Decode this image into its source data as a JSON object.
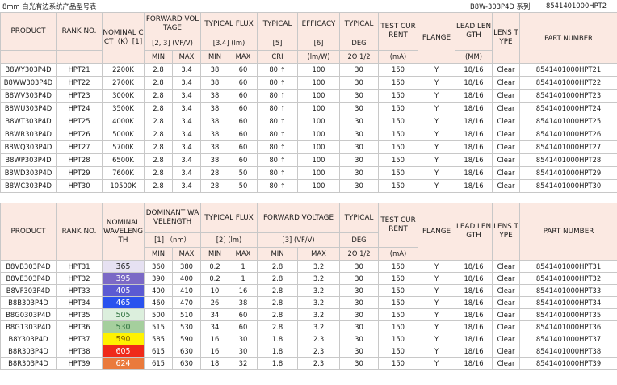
{
  "title": {
    "left": "8mm 白光有边系统产品型号表",
    "middle": "B8W-303P4D 系列",
    "right": "8541401000HPT2"
  },
  "table1": {
    "header": {
      "product": "PRODUCT",
      "rank": "RANK NO.",
      "cct": "NOMINAL CCT（K）[1]",
      "fv": "FORWARD VOLTAGE",
      "fv_sub": "[2, 3] (VF/V)",
      "flux": "TYPICAL FLUX",
      "flux_sub": "[3.4] (lm)",
      "typical": "TYPICAL",
      "typical_sub": "[5]",
      "efficacy": "EFFICACY",
      "efficacy_sub": "[6]",
      "typical2": "TYPICAL",
      "deg": "DEG",
      "test_current": "TEST CURRENT",
      "ma": "(mA)",
      "flange": "FLANGE",
      "lead_length": "LEAD LENGTH",
      "mm": "(MM)",
      "lens_type": "LENS TYPE",
      "part_number": "PART NUMBER",
      "min": "MIN",
      "max": "MAX",
      "min2": "MIN",
      "max2": "MAX",
      "cri": "CRI",
      "lmw": "(lm/W)",
      "angle": "2Θ 1/2"
    },
    "rows": [
      {
        "product": "B8WY303P4D",
        "rank": "HPT21",
        "cct": "2200K",
        "vmin": "2.8",
        "vmax": "3.4",
        "fmin": "38",
        "fmax": "60",
        "cri": "80 ↑",
        "eff": "100",
        "deg": "30",
        "ma": "150",
        "flange": "Y",
        "lead": "18/16",
        "lens": "Clear",
        "part": "8541401000HPT21"
      },
      {
        "product": "B8WW303P4D",
        "rank": "HPT22",
        "cct": "2700K",
        "vmin": "2.8",
        "vmax": "3.4",
        "fmin": "38",
        "fmax": "60",
        "cri": "80 ↑",
        "eff": "100",
        "deg": "30",
        "ma": "150",
        "flange": "Y",
        "lead": "18/16",
        "lens": "Clear",
        "part": "8541401000HPT22"
      },
      {
        "product": "B8WV303P4D",
        "rank": "HPT23",
        "cct": "3000K",
        "vmin": "2.8",
        "vmax": "3.4",
        "fmin": "38",
        "fmax": "60",
        "cri": "80 ↑",
        "eff": "100",
        "deg": "30",
        "ma": "150",
        "flange": "Y",
        "lead": "18/16",
        "lens": "Clear",
        "part": "8541401000HPT23"
      },
      {
        "product": "B8WU303P4D",
        "rank": "HPT24",
        "cct": "3500K",
        "vmin": "2.8",
        "vmax": "3.4",
        "fmin": "38",
        "fmax": "60",
        "cri": "80 ↑",
        "eff": "100",
        "deg": "30",
        "ma": "150",
        "flange": "Y",
        "lead": "18/16",
        "lens": "Clear",
        "part": "8541401000HPT24"
      },
      {
        "product": "B8WT303P4D",
        "rank": "HPT25",
        "cct": "4000K",
        "vmin": "2.8",
        "vmax": "3.4",
        "fmin": "38",
        "fmax": "60",
        "cri": "80 ↑",
        "eff": "100",
        "deg": "30",
        "ma": "150",
        "flange": "Y",
        "lead": "18/16",
        "lens": "Clear",
        "part": "8541401000HPT25"
      },
      {
        "product": "B8WR303P4D",
        "rank": "HPT26",
        "cct": "5000K",
        "vmin": "2.8",
        "vmax": "3.4",
        "fmin": "38",
        "fmax": "60",
        "cri": "80 ↑",
        "eff": "100",
        "deg": "30",
        "ma": "150",
        "flange": "Y",
        "lead": "18/16",
        "lens": "Clear",
        "part": "8541401000HPT26"
      },
      {
        "product": "B8WQ303P4D",
        "rank": "HPT27",
        "cct": "5700K",
        "vmin": "2.8",
        "vmax": "3.4",
        "fmin": "38",
        "fmax": "60",
        "cri": "80 ↑",
        "eff": "100",
        "deg": "30",
        "ma": "150",
        "flange": "Y",
        "lead": "18/16",
        "lens": "Clear",
        "part": "8541401000HPT27"
      },
      {
        "product": "B8WP303P4D",
        "rank": "HPT28",
        "cct": "6500K",
        "vmin": "2.8",
        "vmax": "3.4",
        "fmin": "38",
        "fmax": "60",
        "cri": "80 ↑",
        "eff": "100",
        "deg": "30",
        "ma": "150",
        "flange": "Y",
        "lead": "18/16",
        "lens": "Clear",
        "part": "8541401000HPT28"
      },
      {
        "product": "B8WD303P4D",
        "rank": "HPT29",
        "cct": "7600K",
        "vmin": "2.8",
        "vmax": "3.4",
        "fmin": "28",
        "fmax": "50",
        "cri": "80 ↑",
        "eff": "100",
        "deg": "30",
        "ma": "150",
        "flange": "Y",
        "lead": "18/16",
        "lens": "Clear",
        "part": "8541401000HPT29"
      },
      {
        "product": "B8WC303P4D",
        "rank": "HPT30",
        "cct": "10500K",
        "vmin": "2.8",
        "vmax": "3.4",
        "fmin": "28",
        "fmax": "50",
        "cri": "80 ↑",
        "eff": "100",
        "deg": "30",
        "ma": "150",
        "flange": "Y",
        "lead": "18/16",
        "lens": "Clear",
        "part": "8541401000HPT30"
      }
    ]
  },
  "table2": {
    "header": {
      "product": "PRODUCT",
      "rank": "RANK NO.",
      "wl": "NOMINAL WAVELENGTH",
      "dom": "DOMINANT WAVELENGTH",
      "dom_sub": "[1]  （nm）",
      "flux": "TYPICAL FLUX",
      "flux_sub": "[2] (lm)",
      "fv": "FORWARD VOLTAGE",
      "fv_sub": "[3] (VF/V)",
      "typical": "TYPICAL",
      "deg": "DEG",
      "test_current": "TEST CURRENT",
      "ma": "(mA)",
      "flange": "FLANGE",
      "lead_length": "LEAD LENGTH",
      "mm": "(MM)",
      "lens_type": "LENS TYPE",
      "part_number": "PART NUMBER",
      "min": "MIN",
      "max": "MAX",
      "angle": "2Θ 1/2"
    },
    "rows": [
      {
        "product": "B8VB303P4D",
        "rank": "HPT31",
        "wl": "365",
        "wl_bg": "#e6e1f2",
        "wl_fg": "#222222",
        "dmin": "360",
        "dmax": "380",
        "fmin": "0.2",
        "fmax": "1",
        "vmin": "2.8",
        "vmax": "3.2",
        "deg": "30",
        "ma": "150",
        "flange": "Y",
        "lead": "18/16",
        "lens": "Clear",
        "part": "8541401000HPT31"
      },
      {
        "product": "B8VE303P4D",
        "rank": "HPT32",
        "wl": "395",
        "wl_bg": "#7b69c6",
        "wl_fg": "#ffffff",
        "dmin": "390",
        "dmax": "400",
        "fmin": "0.2",
        "fmax": "1",
        "vmin": "2.8",
        "vmax": "3.2",
        "deg": "30",
        "ma": "150",
        "flange": "Y",
        "lead": "18/16",
        "lens": "Clear",
        "part": "8541401000HPT32"
      },
      {
        "product": "B8VF303P4D",
        "rank": "HPT33",
        "wl": "405",
        "wl_bg": "#5b5ad2",
        "wl_fg": "#ffffff",
        "dmin": "400",
        "dmax": "410",
        "fmin": "10",
        "fmax": "16",
        "vmin": "2.8",
        "vmax": "3.2",
        "deg": "30",
        "ma": "150",
        "flange": "Y",
        "lead": "18/16",
        "lens": "Clear",
        "part": "8541401000HPT33"
      },
      {
        "product": "B8B303P4D",
        "rank": "HPT34",
        "wl": "465",
        "wl_bg": "#2a52ee",
        "wl_fg": "#ffffff",
        "dmin": "460",
        "dmax": "470",
        "fmin": "26",
        "fmax": "38",
        "vmin": "2.8",
        "vmax": "3.2",
        "deg": "30",
        "ma": "150",
        "flange": "Y",
        "lead": "18/16",
        "lens": "Clear",
        "part": "8541401000HPT34"
      },
      {
        "product": "B8G0303P4D",
        "rank": "HPT35",
        "wl": "505",
        "wl_bg": "#dcefdd",
        "wl_fg": "#2a6d3a",
        "dmin": "500",
        "dmax": "510",
        "fmin": "34",
        "fmax": "60",
        "vmin": "2.8",
        "vmax": "3.2",
        "deg": "30",
        "ma": "150",
        "flange": "Y",
        "lead": "18/16",
        "lens": "Clear",
        "part": "8541401000HPT35"
      },
      {
        "product": "B8G1303P4D",
        "rank": "HPT36",
        "wl": "530",
        "wl_bg": "#a5cf9d",
        "wl_fg": "#2a6d3a",
        "dmin": "515",
        "dmax": "530",
        "fmin": "34",
        "fmax": "60",
        "vmin": "2.8",
        "vmax": "3.2",
        "deg": "30",
        "ma": "150",
        "flange": "Y",
        "lead": "18/16",
        "lens": "Clear",
        "part": "8541401000HPT36"
      },
      {
        "product": "B8Y303P4D",
        "rank": "HPT37",
        "wl": "590",
        "wl_bg": "#fff200",
        "wl_fg": "#7a5a00",
        "dmin": "585",
        "dmax": "590",
        "fmin": "16",
        "fmax": "30",
        "vmin": "1.8",
        "vmax": "2.3",
        "deg": "30",
        "ma": "150",
        "flange": "Y",
        "lead": "18/16",
        "lens": "Clear",
        "part": "8541401000HPT37"
      },
      {
        "product": "B8R303P4D",
        "rank": "HPT38",
        "wl": "605",
        "wl_bg": "#ef2a1a",
        "wl_fg": "#ffffff",
        "dmin": "615",
        "dmax": "630",
        "fmin": "16",
        "fmax": "30",
        "vmin": "1.8",
        "vmax": "2.3",
        "deg": "30",
        "ma": "150",
        "flange": "Y",
        "lead": "18/16",
        "lens": "Clear",
        "part": "8541401000HPT38"
      },
      {
        "product": "B8R303P4D",
        "rank": "HPT39",
        "wl": "624",
        "wl_bg": "#ea7a3c",
        "wl_fg": "#ffffff",
        "dmin": "615",
        "dmax": "630",
        "fmin": "18",
        "fmax": "32",
        "vmin": "1.8",
        "vmax": "2.3",
        "deg": "30",
        "ma": "150",
        "flange": "Y",
        "lead": "18/16",
        "lens": "Clear",
        "part": "8541401000HPT39"
      }
    ]
  }
}
